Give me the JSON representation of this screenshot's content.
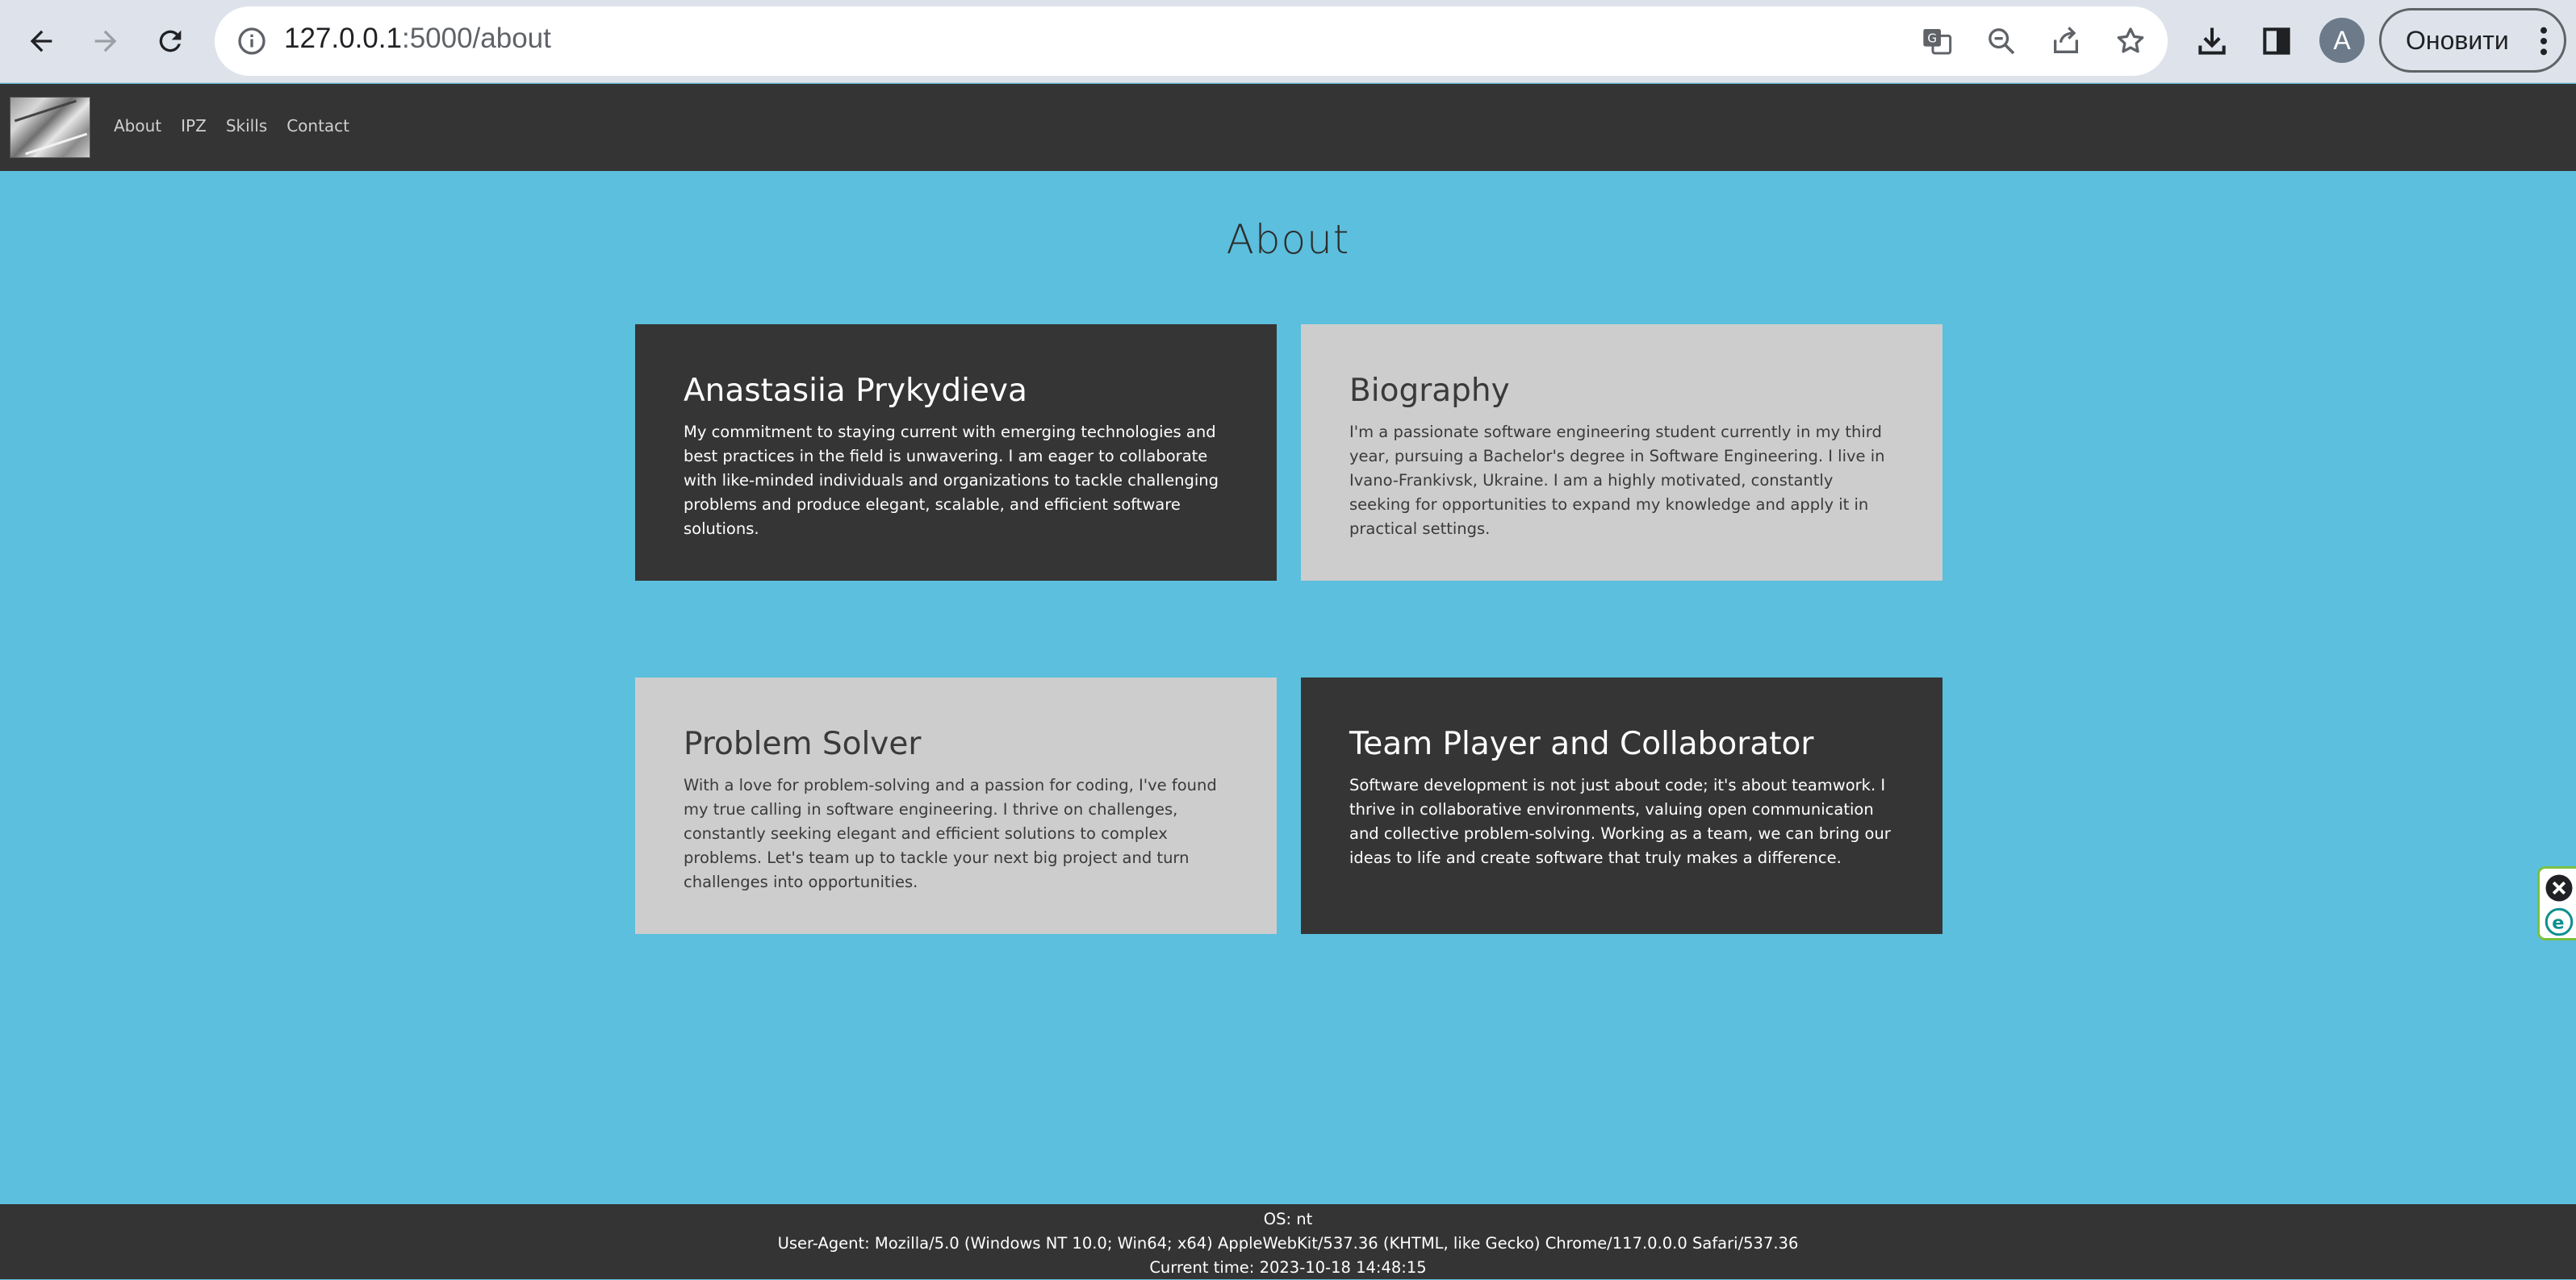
{
  "browser": {
    "url_host": "127.0.0.1",
    "url_path": ":5000/about",
    "profile_initial": "A",
    "update_button_label": "Оновити"
  },
  "site": {
    "nav": [
      "About",
      "IPZ",
      "Skills",
      "Contact"
    ]
  },
  "page": {
    "title": "About",
    "cards": [
      {
        "title": "Anastasiia Prykydieva",
        "text": "My commitment to staying current with emerging technologies and best practices in the field is unwavering. I am eager to collaborate with like-minded individuals and organizations to tackle challenging problems and produce elegant, scalable, and efficient software solutions."
      },
      {
        "title": "Biography",
        "text": "I'm a passionate software engineering student currently in my third year, pursuing a Bachelor's degree in Software Engineering. I live in Ivano-Frankivsk, Ukraine. I am a highly motivated, constantly seeking for opportunities to expand my knowledge and apply it in practical settings."
      },
      {
        "title": "Problem Solver",
        "text": "With a love for problem-solving and a passion for coding, I've found my true calling in software engineering. I thrive on challenges, constantly seeking elegant and efficient solutions to complex problems. Let's team up to tackle your next big project and turn challenges into opportunities."
      },
      {
        "title": "Team Player and Collaborator",
        "text": "Software development is not just about code; it's about teamwork. I thrive in collaborative environments, valuing open communication and collective problem-solving. Working as a team, we can bring our ideas to life and create software that truly makes a difference."
      }
    ]
  },
  "footer": {
    "os": "OS: nt",
    "user_agent": "User-Agent: Mozilla/5.0 (Windows NT 10.0; Win64; x64) AppleWebKit/537.36 (KHTML, like Gecko) Chrome/117.0.0.0 Safari/537.36",
    "time": "Current time: 2023-10-18 14:48:15"
  },
  "colors": {
    "page_bg": "#5bbfdd",
    "header_bg": "#343434",
    "card_dark": "#353535",
    "card_light": "#cdcdcd"
  }
}
